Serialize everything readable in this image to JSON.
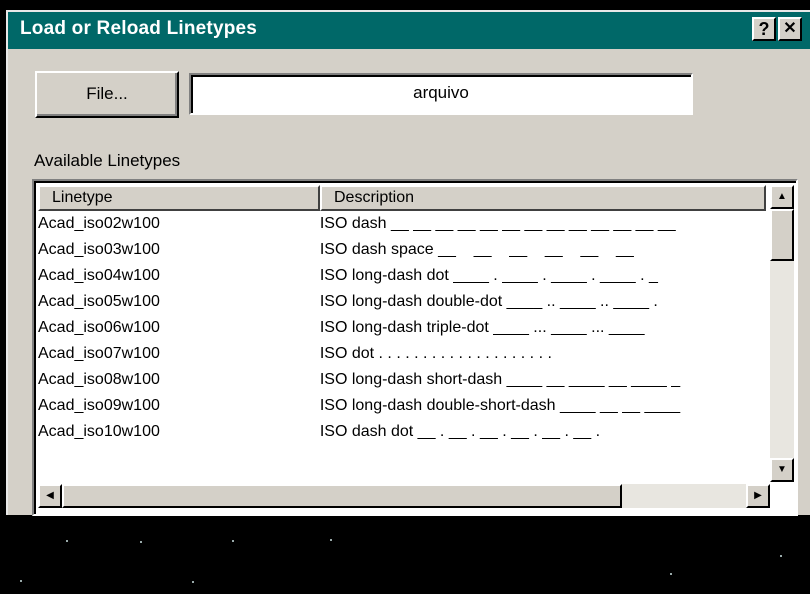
{
  "dialog": {
    "title": "Load or Reload Linetypes",
    "help_label": "?",
    "close_label": "✕"
  },
  "file": {
    "button_label": "File...",
    "filename_value": "arquivo"
  },
  "list": {
    "label": "Available Linetypes",
    "columns": [
      "Linetype",
      "Description"
    ],
    "rows": [
      {
        "linetype": "Acad_iso02w100",
        "description": "ISO dash __ __ __ __ __ __ __ __ __ __ __ __ __"
      },
      {
        "linetype": "Acad_iso03w100",
        "description": "ISO dash space __    __    __    __    __    __"
      },
      {
        "linetype": "Acad_iso04w100",
        "description": "ISO long-dash dot ____ . ____ . ____ . ____ . _"
      },
      {
        "linetype": "Acad_iso05w100",
        "description": "ISO long-dash double-dot ____ .. ____ .. ____ ."
      },
      {
        "linetype": "Acad_iso06w100",
        "description": "ISO long-dash triple-dot ____ ... ____ ... ____"
      },
      {
        "linetype": "Acad_iso07w100",
        "description": "ISO dot . . . . . . . . . . . . . . . . . . . ."
      },
      {
        "linetype": "Acad_iso08w100",
        "description": "ISO long-dash short-dash ____ __ ____ __ ____ _"
      },
      {
        "linetype": "Acad_iso09w100",
        "description": "ISO long-dash double-short-dash ____ __ __ ____"
      },
      {
        "linetype": "Acad_iso10w100",
        "description": "ISO dash dot __ . __ . __ . __ . __ . __ ."
      }
    ]
  },
  "scrollbars": {
    "up_arrow": "▲",
    "down_arrow": "▼",
    "left_arrow": "◀",
    "right_arrow": "▶"
  }
}
